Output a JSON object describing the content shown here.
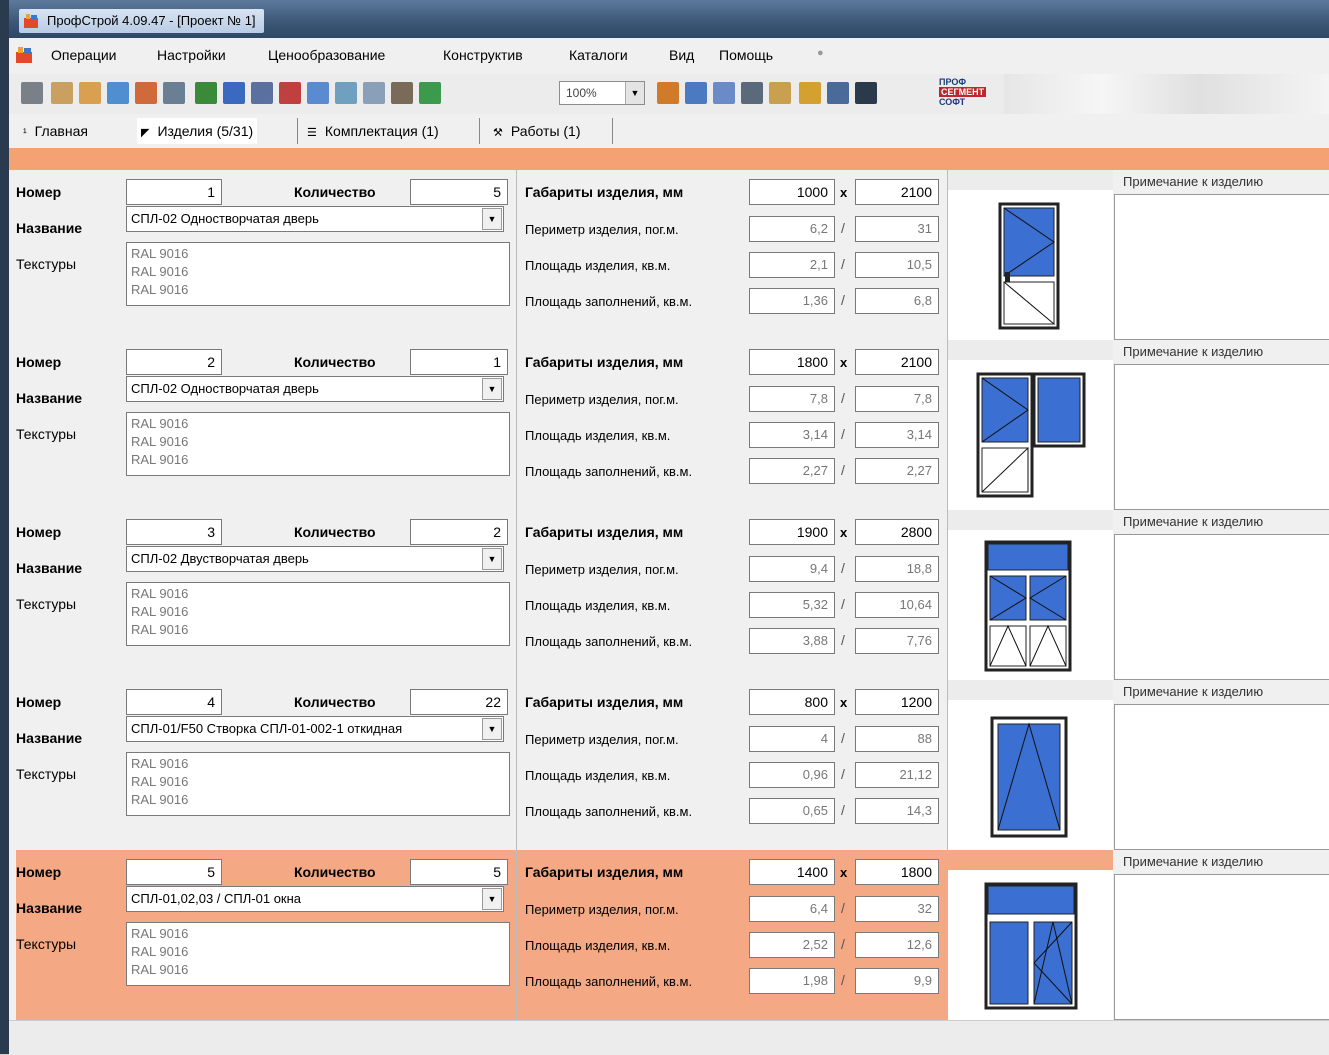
{
  "window": {
    "title": "ПрофСтрой 4.09.47 - [Проект № 1]"
  },
  "menu": [
    "Операции",
    "Настройки",
    "Ценообразование",
    "Конструктив",
    "Каталоги",
    "Вид",
    "Помощь"
  ],
  "toolbar": {
    "zoom": "100%",
    "logo": {
      "line1": "ПРОФ",
      "line2": "СЕГМЕНТ",
      "line3": "СОФТ"
    }
  },
  "tabs": [
    {
      "label": "Главная",
      "icon": "pin-icon"
    },
    {
      "label": "Изделия (5/31)",
      "icon": "flag-icon"
    },
    {
      "label": "Комплектация (1)",
      "icon": "list-icon"
    },
    {
      "label": "Работы (1)",
      "icon": "tool-icon"
    }
  ],
  "labels": {
    "number": "Номер",
    "quantity": "Количество",
    "name": "Название",
    "textures": "Текстуры",
    "dims": "Габариты изделия, мм",
    "perimeter": "Периметр изделия, пог.м.",
    "area": "Площадь изделия, кв.м.",
    "fill_area": "Площадь заполнений, кв.м.",
    "note": "Примечание к изделию",
    "x": "x",
    "slash": "/"
  },
  "colors": {
    "accent": "#f4a173",
    "selected": "#f4a884",
    "glass": "#3b6fd1"
  },
  "products": [
    {
      "number": "1",
      "quantity": "5",
      "name": "СПЛ-02 Одностворчатая дверь",
      "textures": [
        "RAL 9016",
        "RAL 9016",
        "RAL 9016"
      ],
      "width": "1000",
      "height": "2100",
      "perimeter": [
        "6,2",
        "31"
      ],
      "area": [
        "2,1",
        "10,5"
      ],
      "fill_area": [
        "1,36",
        "6,8"
      ],
      "image": "single-door"
    },
    {
      "number": "2",
      "quantity": "1",
      "name": "СПЛ-02 Одностворчатая дверь",
      "textures": [
        "RAL 9016",
        "RAL 9016",
        "RAL 9016"
      ],
      "width": "1800",
      "height": "2100",
      "perimeter": [
        "7,8",
        "7,8"
      ],
      "area": [
        "3,14",
        "3,14"
      ],
      "fill_area": [
        "2,27",
        "2,27"
      ],
      "image": "balcony-door"
    },
    {
      "number": "3",
      "quantity": "2",
      "name": "СПЛ-02 Двустворчатая дверь",
      "textures": [
        "RAL 9016",
        "RAL 9016",
        "RAL 9016"
      ],
      "width": "1900",
      "height": "2800",
      "perimeter": [
        "9,4",
        "18,8"
      ],
      "area": [
        "5,32",
        "10,64"
      ],
      "fill_area": [
        "3,88",
        "7,76"
      ],
      "image": "double-door"
    },
    {
      "number": "4",
      "quantity": "22",
      "name": "СПЛ-01/F50 Створка СПЛ-01-002-1 откидная",
      "textures": [
        "RAL 9016",
        "RAL 9016",
        "RAL 9016"
      ],
      "width": "800",
      "height": "1200",
      "perimeter": [
        "4",
        "88"
      ],
      "area": [
        "0,96",
        "21,12"
      ],
      "fill_area": [
        "0,65",
        "14,3"
      ],
      "image": "tilt-window"
    },
    {
      "number": "5",
      "quantity": "5",
      "name": "СПЛ-01,02,03 / СПЛ-01 окна",
      "textures": [
        "RAL 9016",
        "RAL 9016",
        "RAL 9016"
      ],
      "width": "1400",
      "height": "1800",
      "perimeter": [
        "6,4",
        "32"
      ],
      "area": [
        "2,52",
        "12,6"
      ],
      "fill_area": [
        "1,98",
        "9,9"
      ],
      "image": "two-sash-window",
      "selected": true
    }
  ]
}
